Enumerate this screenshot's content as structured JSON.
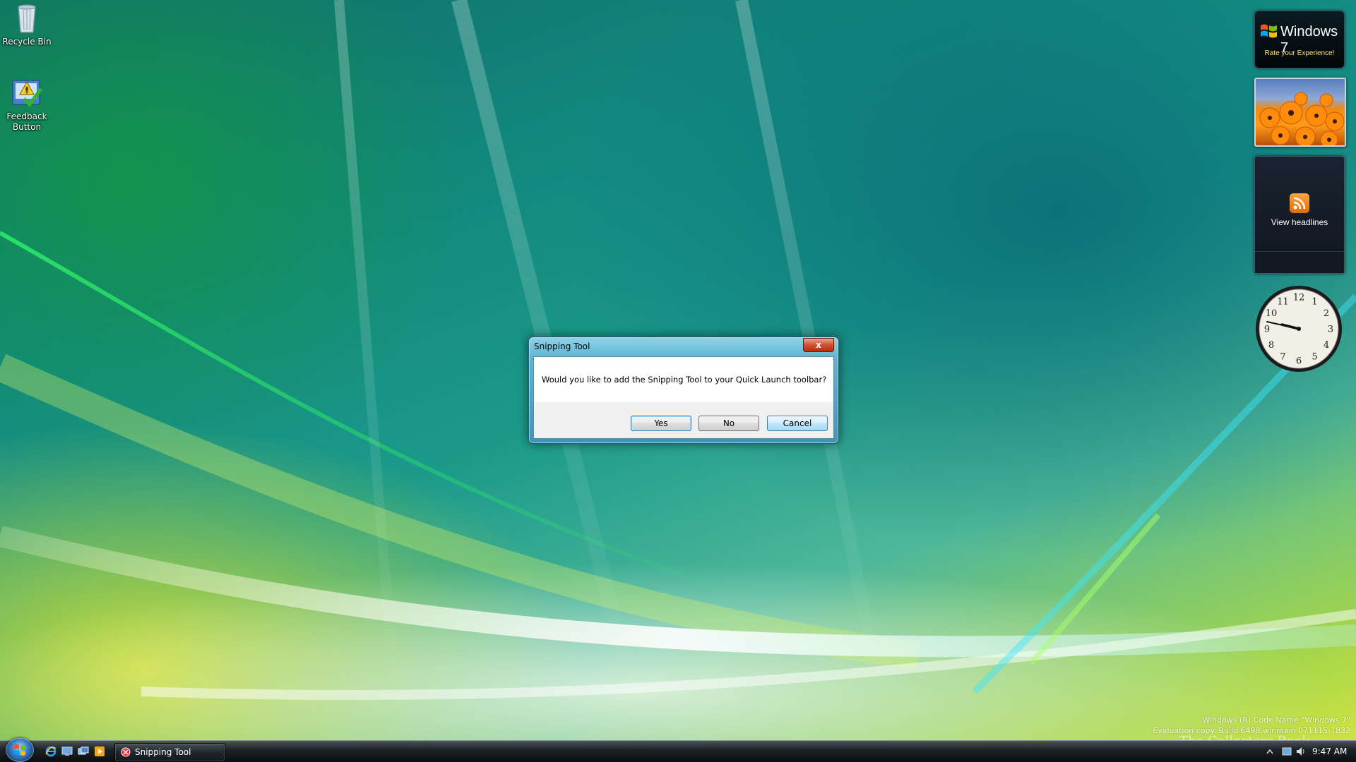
{
  "desktop": {
    "icons": [
      {
        "label": "Recycle Bin",
        "icon": "recycle-bin-icon"
      },
      {
        "label": "Feedback Button",
        "icon": "feedback-icon"
      }
    ]
  },
  "gadgets": {
    "windows7": {
      "brand": "Windows 7",
      "tagline": "Rate your Experience!"
    },
    "feed": {
      "label": "View headlines"
    },
    "clock": {
      "numerals": [
        "12",
        "1",
        "2",
        "3",
        "4",
        "5",
        "6",
        "7",
        "8",
        "9",
        "10",
        "11"
      ],
      "time": "9:47"
    }
  },
  "dialog": {
    "title": "Snipping Tool",
    "close_label": "x",
    "message": "Would you like to add the Snipping Tool to your Quick Launch toolbar?",
    "buttons": {
      "yes": "Yes",
      "no": "No",
      "cancel": "Cancel"
    }
  },
  "watermark": {
    "line1": "Windows (R) Code Name \"Windows 7\"",
    "line2": "Evaluation copy. Build 6498.winmain.071115-1832",
    "site": "The Collectors Book"
  },
  "taskbar": {
    "quick_launch": [
      "internet-explorer-icon",
      "show-desktop-icon",
      "switch-windows-icon",
      "media-player-icon"
    ],
    "tasks": [
      {
        "label": "Snipping Tool",
        "icon": "snipping-tool-icon"
      }
    ],
    "clock": "9:47 AM"
  },
  "colors": {
    "taskbar": "#1c2225",
    "dialog_frame": "#5db5d1",
    "close_button": "#d0502f"
  }
}
